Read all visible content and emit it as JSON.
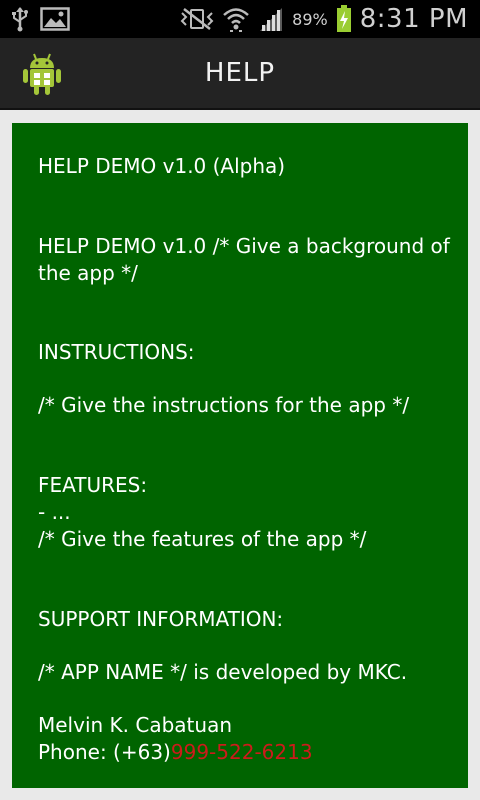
{
  "status_bar": {
    "battery_percent": "89%",
    "time": "8:31 PM",
    "icons": [
      "usb-icon",
      "image-notification-icon",
      "vibrate-mute-icon",
      "wifi-icon",
      "signal-icon",
      "battery-charging-icon"
    ]
  },
  "action_bar": {
    "title": "HELP",
    "app_icon": "android-icon"
  },
  "colors": {
    "panel_background": "#006400",
    "phone_number_color": "#cc1b1b"
  },
  "content": {
    "app_title": "HELP DEMO v1.0 (Alpha)",
    "background_text": "HELP DEMO v1.0 /* Give a background of the app */",
    "instructions_heading": "INSTRUCTIONS:",
    "instructions_text": "/* Give the instructions for the app */",
    "features_heading": "FEATURES:",
    "features_item": "- ...",
    "features_text": "/* Give the features of the app */",
    "support_heading": "SUPPORT INFORMATION:",
    "support_text": "/* APP NAME */ is developed by MKC.",
    "contact_name": "Melvin K. Cabatuan",
    "phone_label": "Phone: (+63)",
    "phone_number": "999-522-6213"
  }
}
